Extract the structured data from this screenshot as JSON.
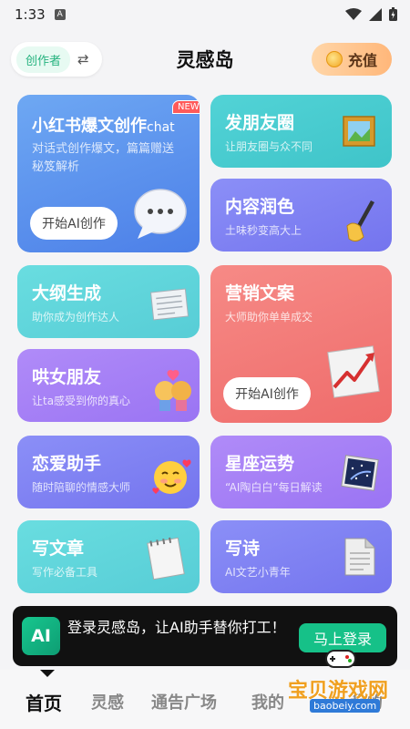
{
  "status_bar": {
    "time": "1:33",
    "notif": "A"
  },
  "header": {
    "mode_label": "创作者",
    "title": "灵感岛",
    "recharge_label": "充值"
  },
  "cards": {
    "xhs": {
      "title": "小红书爆文创作",
      "title_suffix": "chat",
      "badge": "NEW",
      "subtitle": "对话式创作爆文，篇篇赠送秘笈解析",
      "button": "开始AI创作"
    },
    "moments": {
      "title": "发朋友圈",
      "subtitle": "让朋友圈与众不同"
    },
    "polish": {
      "title": "内容润色",
      "subtitle": "土味秒变高大上"
    },
    "outline": {
      "title": "大纲生成",
      "subtitle": "助你成为创作达人"
    },
    "marketing": {
      "title": "营销文案",
      "subtitle": "大师助你单单成交",
      "button": "开始AI创作"
    },
    "coax": {
      "title": "哄女朋友",
      "subtitle": "让ta感受到你的真心"
    },
    "love": {
      "title": "恋爱助手",
      "subtitle": "随时陪聊的情感大师"
    },
    "horoscope": {
      "title": "星座运势",
      "subtitle": "“AI陶白白”每日解读"
    },
    "article": {
      "title": "写文章",
      "subtitle": "写作必备工具"
    },
    "poem": {
      "title": "写诗",
      "subtitle": "AI文艺小青年"
    }
  },
  "login_banner": {
    "logo": "AI",
    "text": "登录灵感岛，让AI助手替你打工！",
    "button": "马上登录"
  },
  "bottom_nav": {
    "items": [
      "首页",
      "灵感",
      "通告广场",
      "我的",
      "我的"
    ]
  },
  "watermark": {
    "text": "宝贝游戏网",
    "url": "baobeiy.com"
  },
  "colors": {
    "accent_green": "#16c188",
    "recharge_orange": "#ffb77a"
  }
}
